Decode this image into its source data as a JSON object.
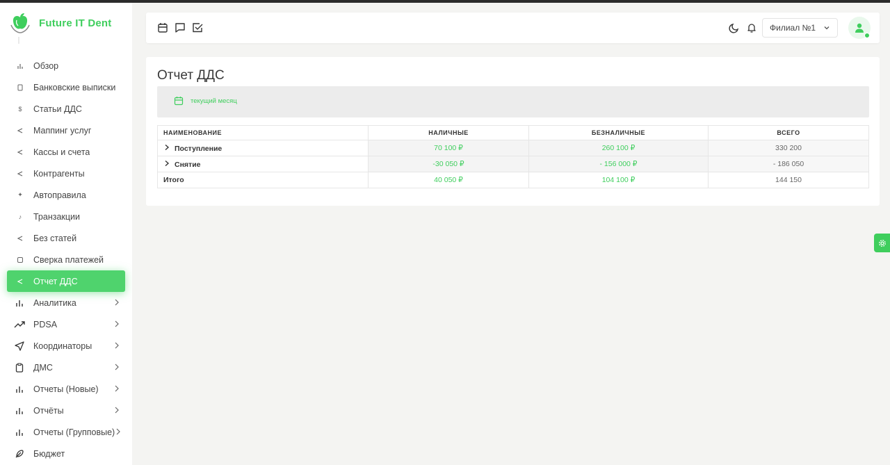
{
  "app": {
    "brand_name": "Future IT Dent",
    "accent_color": "#3fce5d"
  },
  "sidebar": {
    "items": [
      {
        "label": "Обзор",
        "icon": "chart-icon",
        "active": false
      },
      {
        "label": "Банковские выписки",
        "icon": "document-icon",
        "active": false
      },
      {
        "label": "Статьи ДДС",
        "icon": "dollar-icon",
        "active": false
      },
      {
        "label": "Маппинг услуг",
        "icon": "share-icon",
        "active": false
      },
      {
        "label": "Кассы и счета",
        "icon": "share-icon",
        "active": false
      },
      {
        "label": "Контрагенты",
        "icon": "share-icon",
        "active": false
      },
      {
        "label": "Автоправила",
        "icon": "sparkle-icon",
        "active": false
      },
      {
        "label": "Транзакции",
        "icon": "music-note-icon",
        "active": false
      },
      {
        "label": "Без статей",
        "icon": "share-icon",
        "active": false
      },
      {
        "label": "Сверка платежей",
        "icon": "reconcile-icon",
        "active": false
      },
      {
        "label": "Отчет ДДС",
        "icon": "share-icon",
        "active": true
      },
      {
        "label": "Аналитика",
        "icon": "bar-chart-icon",
        "active": false
      },
      {
        "label": "PDSA",
        "icon": "trending-up-icon",
        "active": false
      },
      {
        "label": "Координаторы",
        "icon": "send-icon",
        "active": false
      },
      {
        "label": "ДМС",
        "icon": "clipboard-icon",
        "active": false
      },
      {
        "label": "Отчеты (Новые)",
        "icon": "bar-chart-icon",
        "active": false
      },
      {
        "label": "Отчёты",
        "icon": "bar-chart-icon",
        "active": false
      },
      {
        "label": "Отчеты (Групповые)",
        "icon": "bar-chart-icon",
        "active": false
      },
      {
        "label": "Бюджет",
        "icon": "feather-icon",
        "active": false
      }
    ]
  },
  "header": {
    "branch_select": "Филиал №1"
  },
  "main": {
    "title": "Отчет ДДС",
    "period_filter": "текущий месяц",
    "table": {
      "headers": [
        "НАИМЕНОВАНИЕ",
        "НАЛИЧНЫЕ",
        "БЕЗНАЛИЧНЫЕ",
        "ВСЕГО"
      ],
      "rows": [
        {
          "name": "Поступление",
          "cash": "70 100 ₽",
          "noncash": "260 100 ₽",
          "total": "330 200"
        },
        {
          "name": "Снятие",
          "cash": "-30 050 ₽",
          "noncash": "- 156 000 ₽",
          "total": "- 186 050"
        },
        {
          "name": "Итого",
          "cash": "40 050 ₽",
          "noncash": "104 100 ₽",
          "total": "144 150"
        }
      ]
    }
  }
}
